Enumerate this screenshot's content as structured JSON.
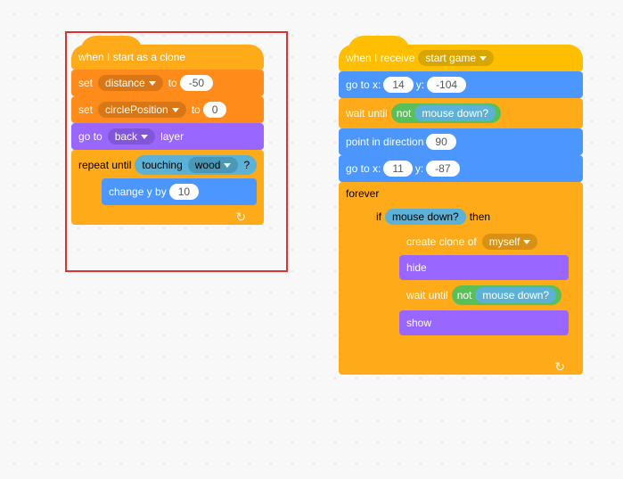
{
  "left": {
    "hat": "when I start as a clone",
    "set1_lbl": "set",
    "set1_var": "distance",
    "set1_to": "to",
    "set1_val": "-50",
    "set2_lbl": "set",
    "set2_var": "circlePosition",
    "set2_to": "to",
    "set2_val": "0",
    "goto_lbl": "go to",
    "goto_opt": "back",
    "goto_sfx": "layer",
    "repeat_lbl": "repeat until",
    "touch_lbl": "touching",
    "touch_opt": "wood",
    "touch_sfx": "?",
    "chy_lbl": "change y by",
    "chy_val": "10"
  },
  "right": {
    "hat_lbl": "when I receive",
    "hat_opt": "start game",
    "goto1_lbl": "go to x:",
    "goto1_x": "14",
    "goto1_y_lbl": "y:",
    "goto1_y": "-104",
    "wait1_lbl": "wait until",
    "not1_lbl": "not",
    "md1_lbl": "mouse down?",
    "point_lbl": "point in direction",
    "point_val": "90",
    "goto2_lbl": "go to x:",
    "goto2_x": "11",
    "goto2_y_lbl": "y:",
    "goto2_y": "-87",
    "forever_lbl": "forever",
    "if_lbl": "if",
    "if_md": "mouse down?",
    "if_then": "then",
    "clone_lbl": "create clone of",
    "clone_opt": "myself",
    "hide_lbl": "hide",
    "wait2_lbl": "wait until",
    "not2_lbl": "not",
    "md2_lbl": "mouse down?",
    "show_lbl": "show"
  }
}
